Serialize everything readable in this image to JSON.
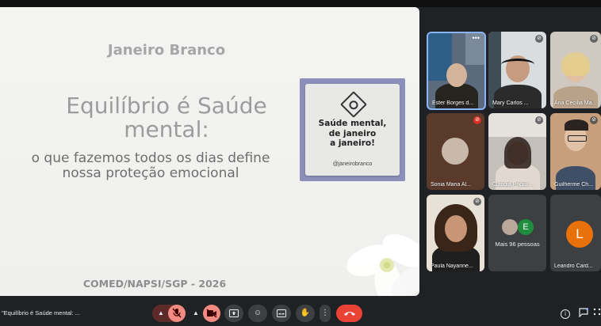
{
  "presentation": {
    "brand": "Janeiro Branco",
    "title_line1": "Equilíbrio é Saúde",
    "title_line2": "mental:",
    "subtitle_line1": "o que fazemos todos os dias define",
    "subtitle_line2": "nossa proteção emocional",
    "footer": "COMED/NAPSI/SGP - 2026",
    "card_line1": "Saúde mental,",
    "card_line2": "de janeiro",
    "card_line3": "a janeiro!",
    "card_handle": "@janeirobranco"
  },
  "participants": [
    {
      "name": "Ester Borges d..."
    },
    {
      "name": "Mary Carlos ..."
    },
    {
      "name": "Ana Cecília Ma..."
    },
    {
      "name": "Sonia Maria Al..."
    },
    {
      "name": "Claudia Pricila ..."
    },
    {
      "name": "Guilherme Ch..."
    },
    {
      "name": "Paula Nayanne..."
    },
    {
      "name": "Leandro Card...",
      "initial": "L"
    }
  ],
  "others": {
    "initial": "E",
    "label": "Mais 96 pessoas"
  },
  "bottom_bar": {
    "meeting_caption": "\"Equilíbrio é Saúde mental: ..."
  },
  "colors": {
    "accent_orange": "#e8710a",
    "end_call_red": "#ea4335",
    "muted_red": "#f28b82",
    "slide_card_purple": "#8c8fb9"
  }
}
